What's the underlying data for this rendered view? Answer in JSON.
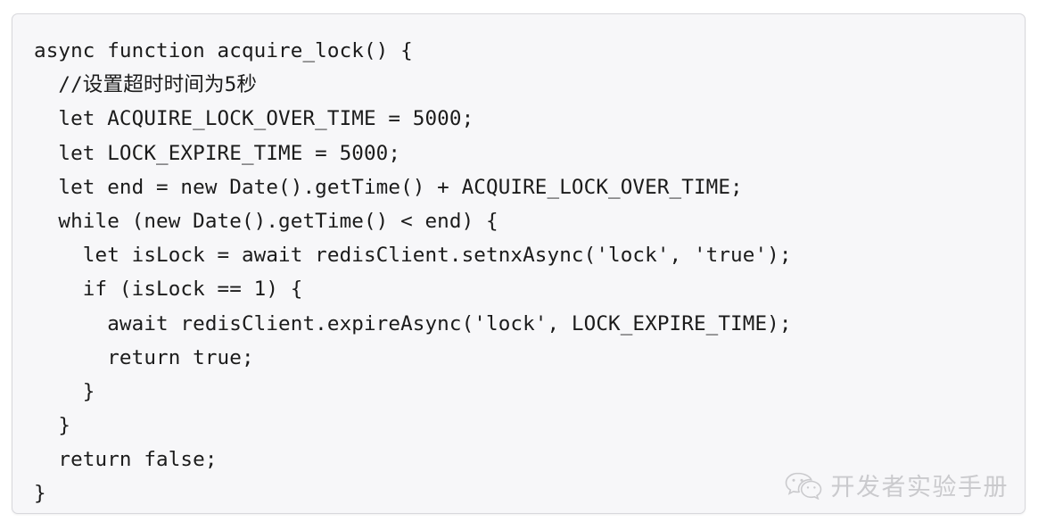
{
  "card": {
    "background_color": "#f7f7f9",
    "border_color": "#d8d8dc",
    "language": "javascript"
  },
  "code": {
    "lines": [
      "async function acquire_lock() {",
      "  //设置超时时间为5秒",
      "  let ACQUIRE_LOCK_OVER_TIME = 5000;",
      "  let LOCK_EXPIRE_TIME = 5000;",
      "  let end = new Date().getTime() + ACQUIRE_LOCK_OVER_TIME;",
      "  while (new Date().getTime() < end) {",
      "    let isLock = await redisClient.setnxAsync('lock', 'true');",
      "    if (isLock == 1) {",
      "      await redisClient.expireAsync('lock', LOCK_EXPIRE_TIME);",
      "      return true;",
      "    }",
      "  }",
      "  return false;",
      "}"
    ]
  },
  "watermark": {
    "text": "开发者实验手册",
    "icon": "wechat-icon",
    "color": "#8e8e93"
  }
}
